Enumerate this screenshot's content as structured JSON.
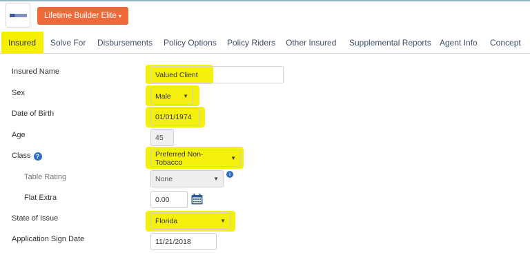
{
  "header": {
    "product_button_label": "Lifetime Builder Elite",
    "caret": "▾"
  },
  "tabs": [
    {
      "label": "Insured",
      "active": true
    },
    {
      "label": "Solve For"
    },
    {
      "label": "Disbursements"
    },
    {
      "label": "Policy Options"
    },
    {
      "label": "Policy Riders"
    },
    {
      "label": "Other Insured"
    },
    {
      "label": "Supplemental Reports"
    },
    {
      "label": "Agent Info"
    },
    {
      "label": "Concept"
    }
  ],
  "form": {
    "insured_name": {
      "label": "Insured Name",
      "value": "Valued Client"
    },
    "sex": {
      "label": "Sex",
      "value": "Male"
    },
    "dob": {
      "label": "Date of Birth",
      "value": "01/01/1974"
    },
    "age": {
      "label": "Age",
      "value": "45"
    },
    "class": {
      "label": "Class",
      "value": "Preferred Non-Tobacco"
    },
    "table_rating": {
      "label": "Table Rating",
      "value": "None"
    },
    "flat_extra": {
      "label": "Flat Extra",
      "value": "0.00"
    },
    "state": {
      "label": "State of Issue",
      "value": "Florida"
    },
    "sign_date": {
      "label": "Application Sign Date",
      "value": "11/21/2018"
    }
  },
  "icons": {
    "help": "?",
    "info": "i",
    "select_caret": "▼"
  },
  "colors": {
    "accent_button": "#ef6a3b",
    "highlight": "#f5ef00",
    "help_icon": "#2d6dbf"
  }
}
